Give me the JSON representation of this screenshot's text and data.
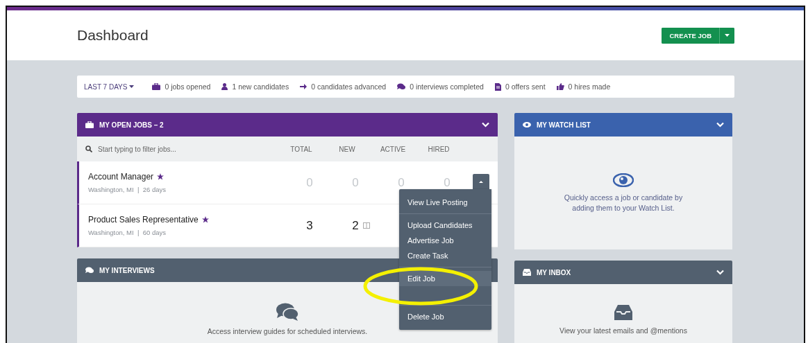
{
  "header": {
    "title": "Dashboard",
    "create_button": "CREATE JOB"
  },
  "stats": {
    "range": "LAST 7 DAYS",
    "items": [
      {
        "kind": "briefcase",
        "text": "0 jobs opened"
      },
      {
        "kind": "user",
        "text": "1 new candidates"
      },
      {
        "kind": "arrow",
        "text": "0 candidates advanced"
      },
      {
        "kind": "chat",
        "text": "0 interviews completed"
      },
      {
        "kind": "document",
        "text": "0 offers sent"
      },
      {
        "kind": "thumb",
        "text": "0 hires made"
      }
    ]
  },
  "open_jobs": {
    "title": "MY OPEN JOBS  –  2",
    "filter_placeholder": "Start typing to filter jobs...",
    "columns": [
      "TOTAL",
      "NEW",
      "ACTIVE",
      "HIRED"
    ],
    "rows": [
      {
        "title": "Account Manager",
        "starred": true,
        "location": "Washington, MI  |  26 days",
        "counts": [
          "0",
          "0",
          "0",
          "0"
        ],
        "menu_open": true,
        "note": false
      },
      {
        "title": "Product Sales Representative",
        "starred": true,
        "location": "Washington, MI  |  60 days",
        "counts": [
          "3",
          "2"
        ],
        "menu_open": false,
        "note": true
      }
    ]
  },
  "job_menu": {
    "groups": [
      [
        {
          "label": "View Live Posting",
          "highlighted": false
        }
      ],
      [
        {
          "label": "Upload Candidates",
          "highlighted": false
        },
        {
          "label": "Advertise Job",
          "highlighted": false
        },
        {
          "label": "Create Task",
          "highlighted": false
        }
      ],
      [
        {
          "label": "Edit Job",
          "highlighted": true
        }
      ],
      [
        {
          "label": "Delete Job",
          "highlighted": false
        }
      ]
    ]
  },
  "interviews": {
    "title": "MY INTERVIEWS",
    "message": "Access interview guides for scheduled interviews."
  },
  "watch_list": {
    "title": "MY WATCH LIST",
    "message": "Quickly access a job or candidate by adding them to your Watch List."
  },
  "inbox": {
    "title": "MY INBOX",
    "message": "View your latest emails and @mentions"
  }
}
